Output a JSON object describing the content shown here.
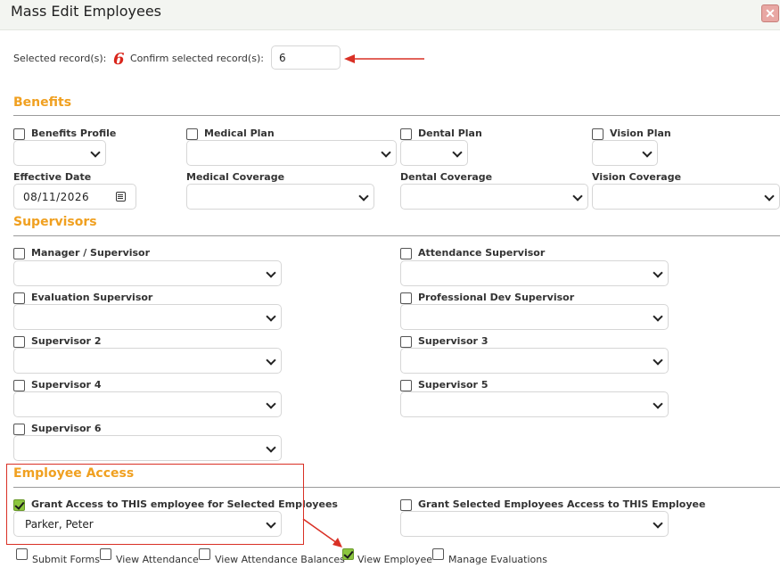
{
  "window": {
    "title": "Mass Edit Employees",
    "close_glyph": "✕"
  },
  "selection": {
    "selected_label": "Selected record(s):",
    "selected_count": "6",
    "confirm_label": "Confirm selected record(s):",
    "confirm_value": "6"
  },
  "benefits": {
    "heading": "Benefits",
    "benefits_profile": "Benefits Profile",
    "medical_plan": "Medical Plan",
    "dental_plan": "Dental Plan",
    "vision_plan": "Vision Plan",
    "effective_date_label": "Effective Date",
    "effective_date_value": "08/11/2026",
    "medical_coverage": "Medical Coverage",
    "dental_coverage": "Dental Coverage",
    "vision_coverage": "Vision Coverage"
  },
  "supervisors": {
    "heading": "Supervisors",
    "manager": "Manager / Supervisor",
    "attendance": "Attendance Supervisor",
    "evaluation": "Evaluation Supervisor",
    "professional_dev": "Professional Dev Supervisor",
    "sup2": "Supervisor 2",
    "sup3": "Supervisor 3",
    "sup4": "Supervisor 4",
    "sup5": "Supervisor 5",
    "sup6": "Supervisor 6"
  },
  "access": {
    "heading": "Employee Access",
    "grant_this": "Grant Access to THIS employee for Selected Employees",
    "grant_this_checked": true,
    "grant_this_value": "Parker, Peter",
    "grant_selected": "Grant Selected Employees Access to THIS Employee",
    "perms": {
      "submit_forms": "Submit Forms",
      "view_attendance": "View Attendance",
      "view_attendance_balances": "View Attendance Balances",
      "view_employee": "View Employee",
      "manage_evaluations": "Manage Evaluations"
    },
    "view_employee_checked": true
  },
  "colors": {
    "accent": "#f0a020",
    "annotation": "#d93025",
    "check": "#8cc63f"
  }
}
